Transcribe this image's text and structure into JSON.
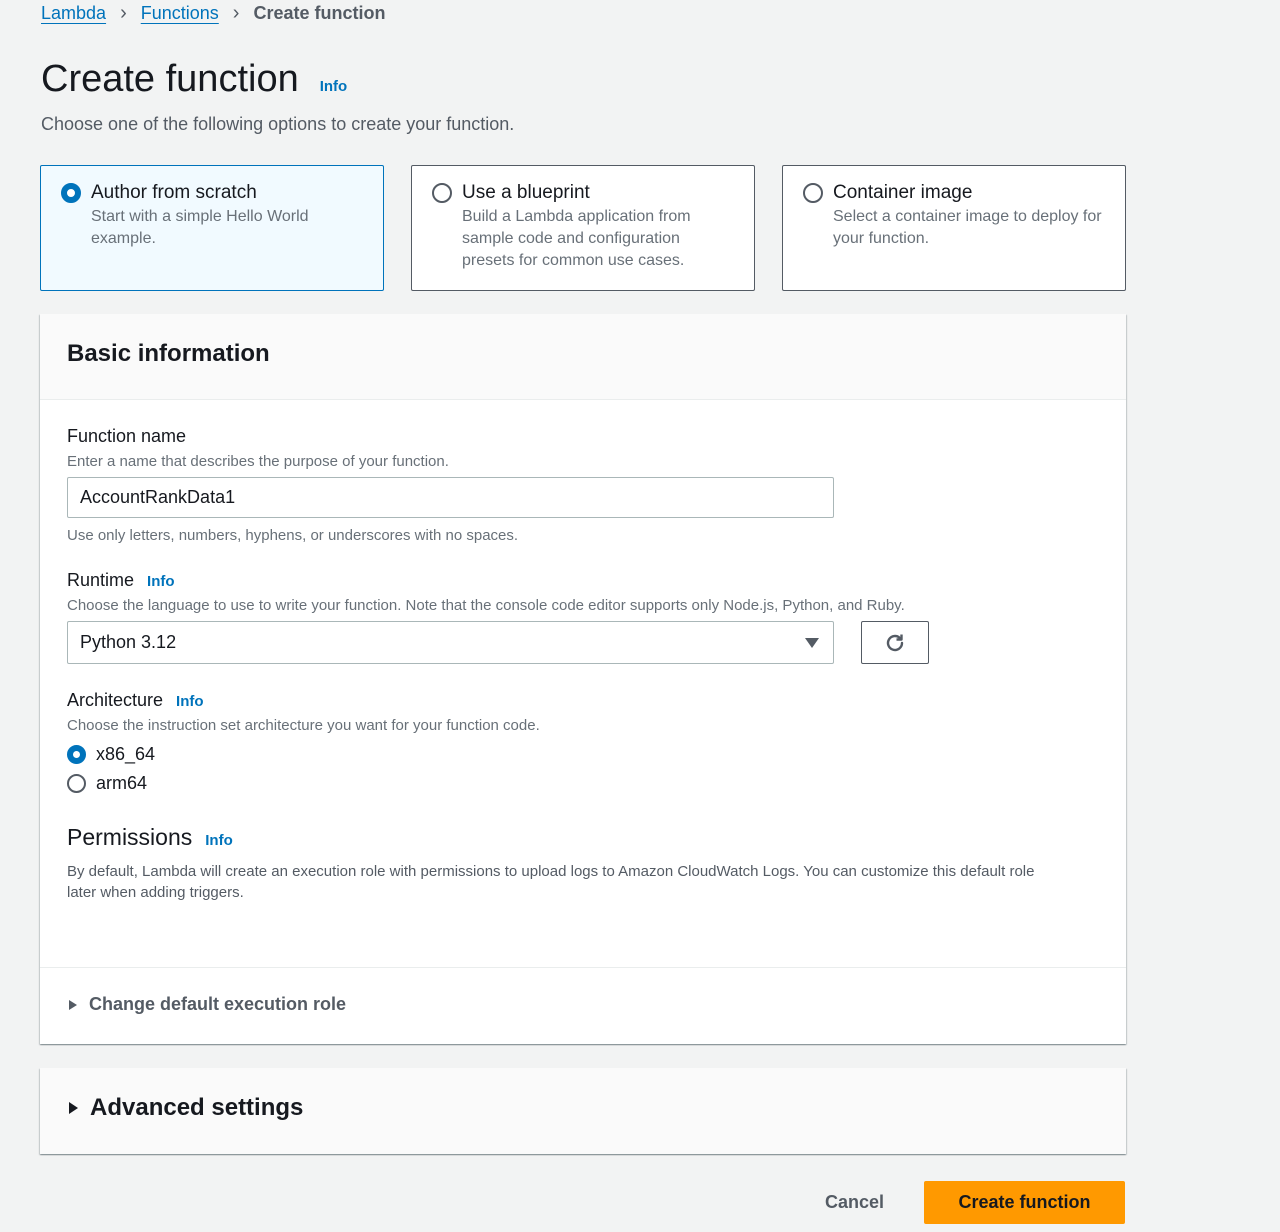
{
  "breadcrumb": [
    {
      "label": "Lambda",
      "link": true
    },
    {
      "label": "Functions",
      "link": true
    },
    {
      "label": "Create function",
      "link": false
    }
  ],
  "header": {
    "title": "Create function",
    "info": "Info",
    "subtitle": "Choose one of the following options to create your function."
  },
  "options": [
    {
      "title": "Author from scratch",
      "description": "Start with a simple Hello World example.",
      "selected": true
    },
    {
      "title": "Use a blueprint",
      "description": "Build a Lambda application from sample code and configuration presets for common use cases.",
      "selected": false
    },
    {
      "title": "Container image",
      "description": "Select a container image to deploy for your function.",
      "selected": false
    }
  ],
  "basic_info": {
    "heading": "Basic information",
    "function_name": {
      "label": "Function name",
      "description": "Enter a name that describes the purpose of your function.",
      "value": "AccountRankData1",
      "constraint": "Use only letters, numbers, hyphens, or underscores with no spaces."
    },
    "runtime": {
      "label": "Runtime",
      "info": "Info",
      "description": "Choose the language to use to write your function. Note that the console code editor supports only Node.js, Python, and Ruby.",
      "selected": "Python 3.12"
    },
    "architecture": {
      "label": "Architecture",
      "info": "Info",
      "description": "Choose the instruction set architecture you want for your function code.",
      "options": [
        {
          "label": "x86_64",
          "selected": true
        },
        {
          "label": "arm64",
          "selected": false
        }
      ]
    },
    "permissions": {
      "label": "Permissions",
      "info": "Info",
      "description": "By default, Lambda will create an execution role with permissions to upload logs to Amazon CloudWatch Logs. You can customize this default role later when adding triggers."
    },
    "role_expander": "Change default execution role"
  },
  "advanced": {
    "label": "Advanced settings"
  },
  "actions": {
    "cancel": "Cancel",
    "create": "Create function"
  }
}
